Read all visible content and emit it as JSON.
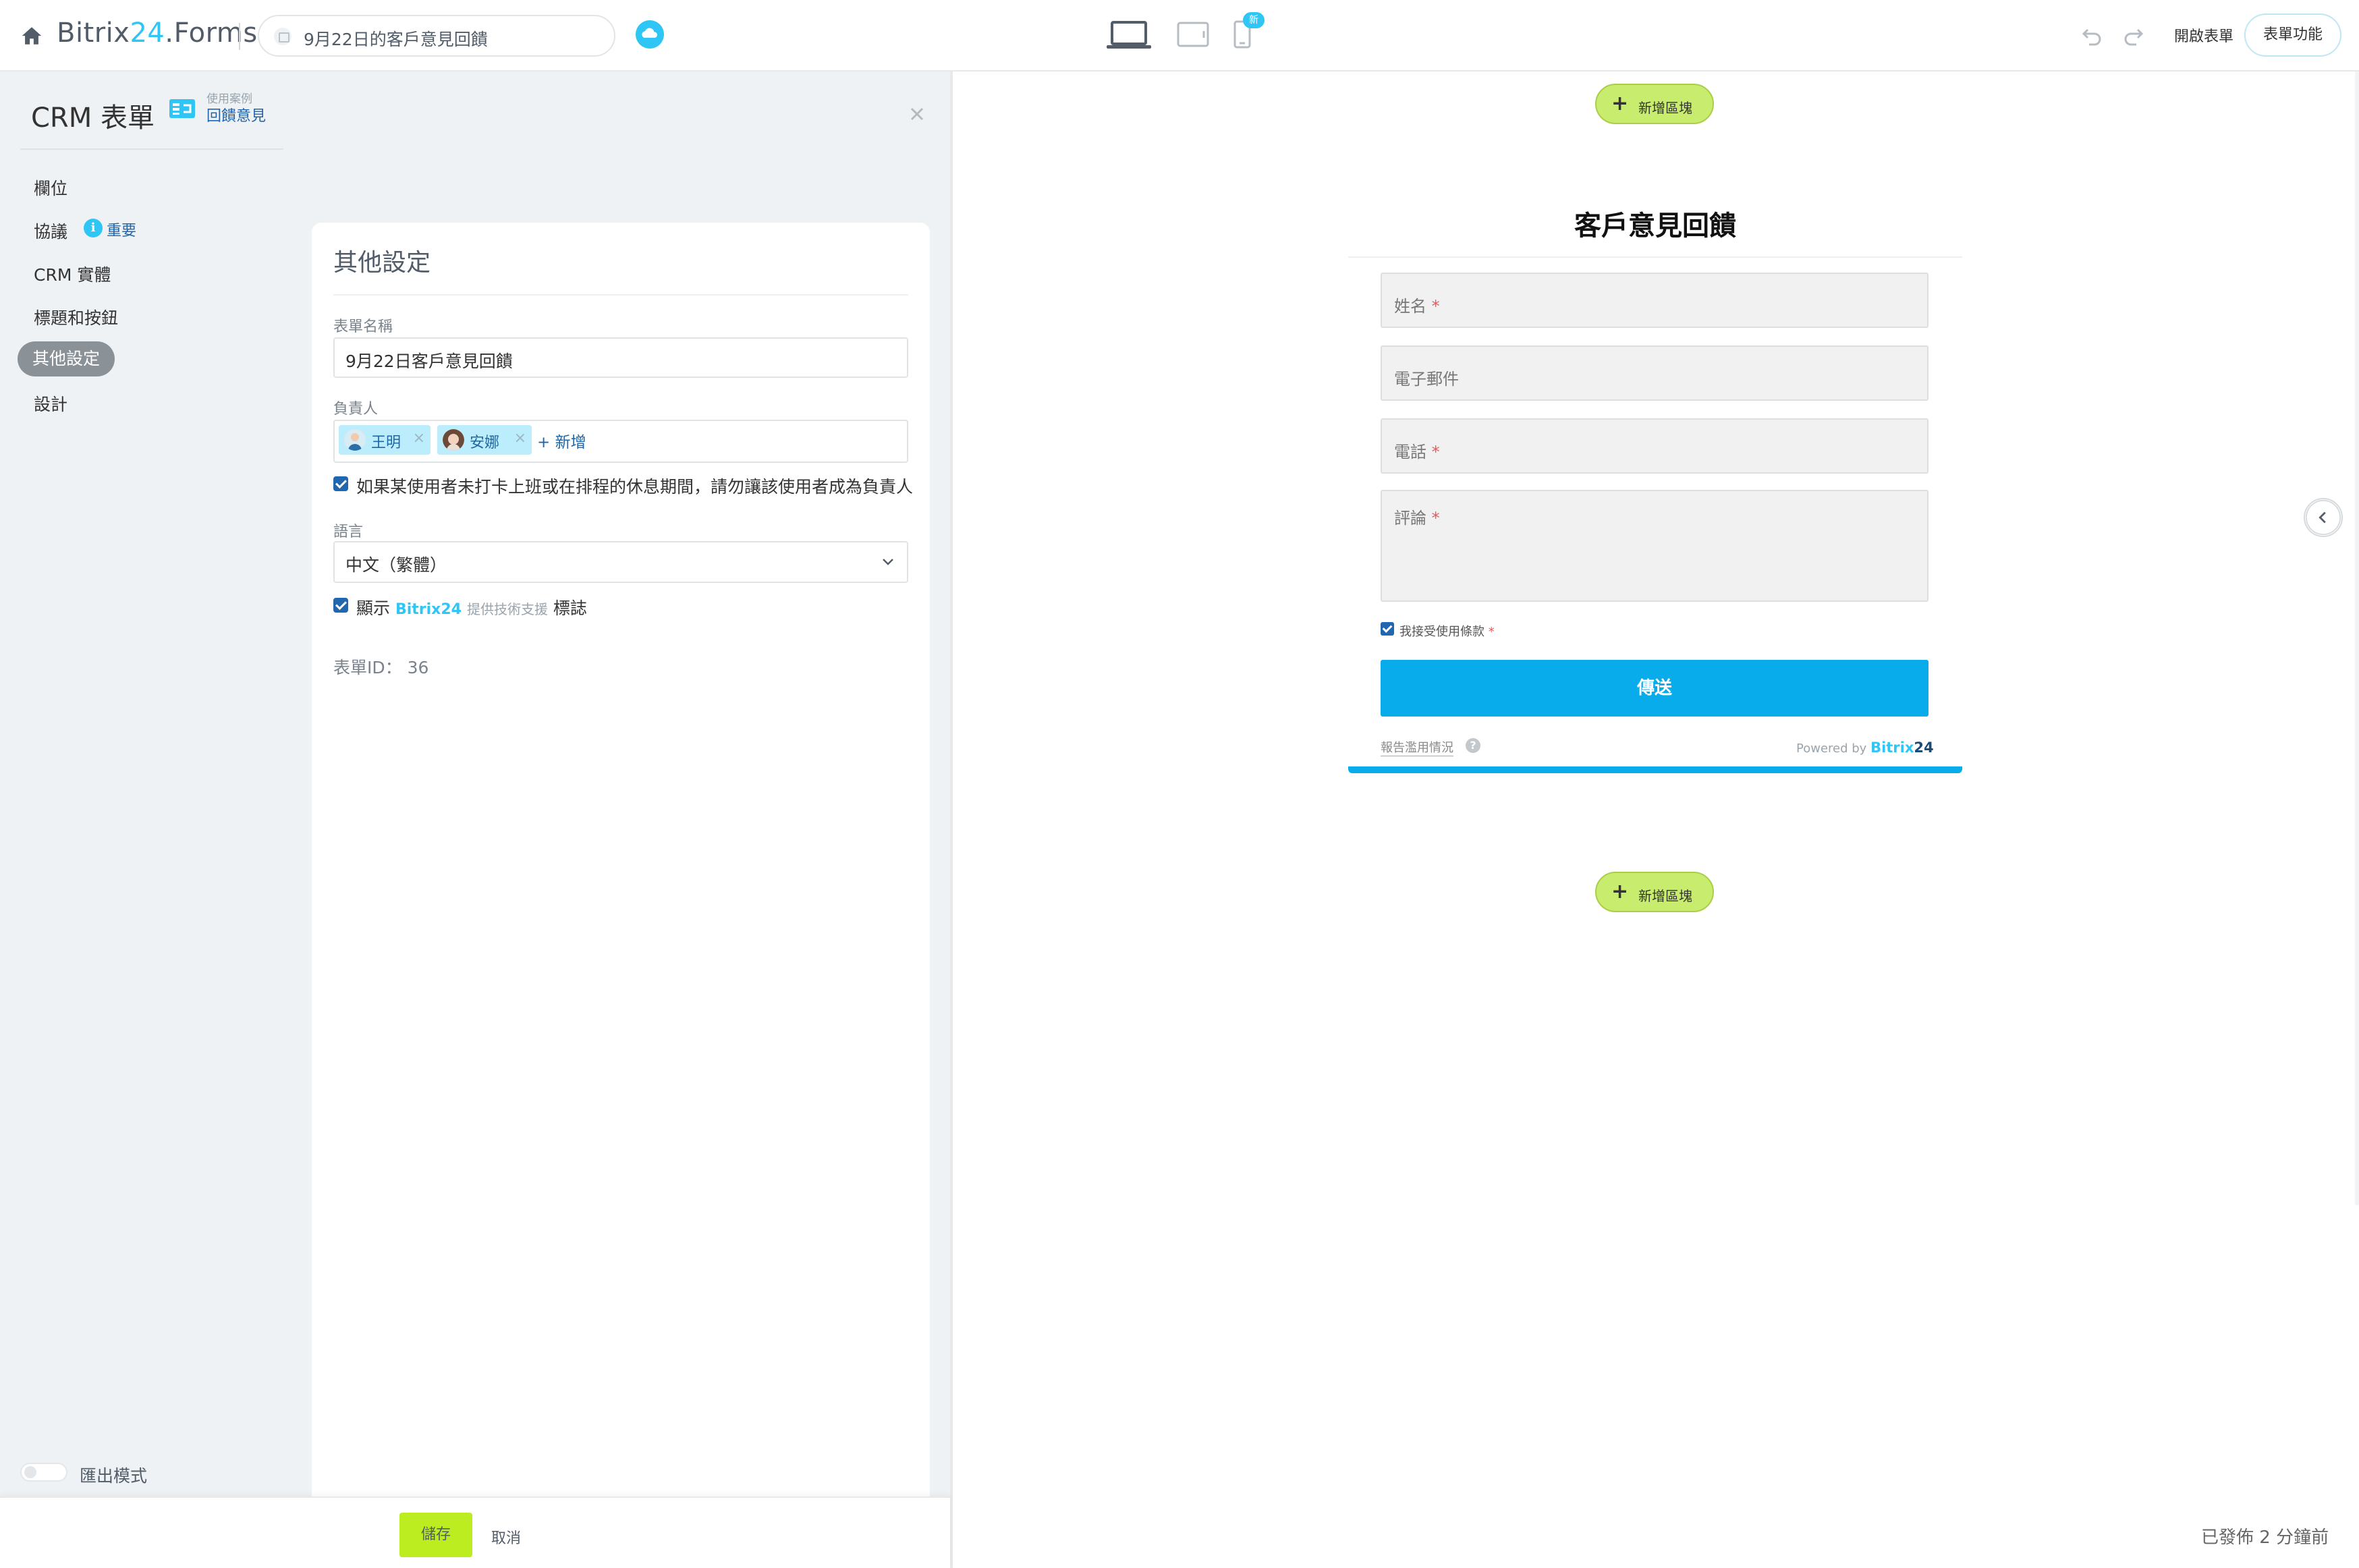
{
  "app": {
    "logo_main": "Bitrix",
    "logo_24": "24",
    "logo_suffix": ".Forms",
    "form_title_pill": "9月22日的客戶意見回饋",
    "new_badge": "新",
    "open_form": "開啟表單",
    "form_functions": "表單功能"
  },
  "sidebar": {
    "title": "CRM 表單",
    "usecase_small": "使用案例",
    "usecase_link": "回饋意見",
    "items": [
      {
        "label": "欄位"
      },
      {
        "label": "協議",
        "badge": "重要"
      },
      {
        "label": "CRM 實體"
      },
      {
        "label": "標題和按鈕"
      },
      {
        "label": "其他設定"
      },
      {
        "label": "設計"
      }
    ],
    "export_mode": "匯出模式"
  },
  "settings": {
    "title": "其他設定",
    "form_name_label": "表單名稱",
    "form_name_value": "9月22日客戶意見回饋",
    "responsible_label": "負責人",
    "responsible": [
      {
        "name": "王明"
      },
      {
        "name": "安娜"
      }
    ],
    "add_label": "新增",
    "absence_checkbox": "如果某使用者未打卡上班或在排程的休息期間，請勿讓該使用者成為負責人",
    "language_label": "語言",
    "language_value": "中文（繁體）",
    "logo_check_prefix": "顯示",
    "logo_check_brand": "Bitrix24",
    "logo_check_support": "提供技術支援",
    "logo_check_suffix": "標誌",
    "form_id_label": "表單ID：",
    "form_id": "36"
  },
  "actions": {
    "save": "儲存",
    "cancel": "取消"
  },
  "preview": {
    "add_block": "新增區塊",
    "form_title": "客戶意見回饋",
    "fields": [
      {
        "placeholder": "姓名",
        "required": true
      },
      {
        "placeholder": "電子郵件",
        "required": false
      },
      {
        "placeholder": "電話",
        "required": true
      },
      {
        "placeholder": "評論",
        "required": true
      }
    ],
    "terms": "我接受使用條款",
    "send": "傳送",
    "report_abuse": "報告濫用情況",
    "powered_by": "Powered by",
    "powered_brand": "Bitrix",
    "powered_num": "24",
    "published": "已發佈 2 分鐘前"
  },
  "colors": {
    "accent": "#2fc6f6",
    "save_green": "#bbed21",
    "send_blue": "#08acea",
    "add_block_green": "#c8ec6d"
  },
  "icons": [
    "home-icon",
    "cloud-icon",
    "laptop-icon",
    "tablet-icon",
    "phone-icon",
    "undo-icon",
    "redo-icon",
    "close-icon",
    "info-icon",
    "chevron-down-icon",
    "chevron-left-icon",
    "plus-icon",
    "help-icon"
  ]
}
